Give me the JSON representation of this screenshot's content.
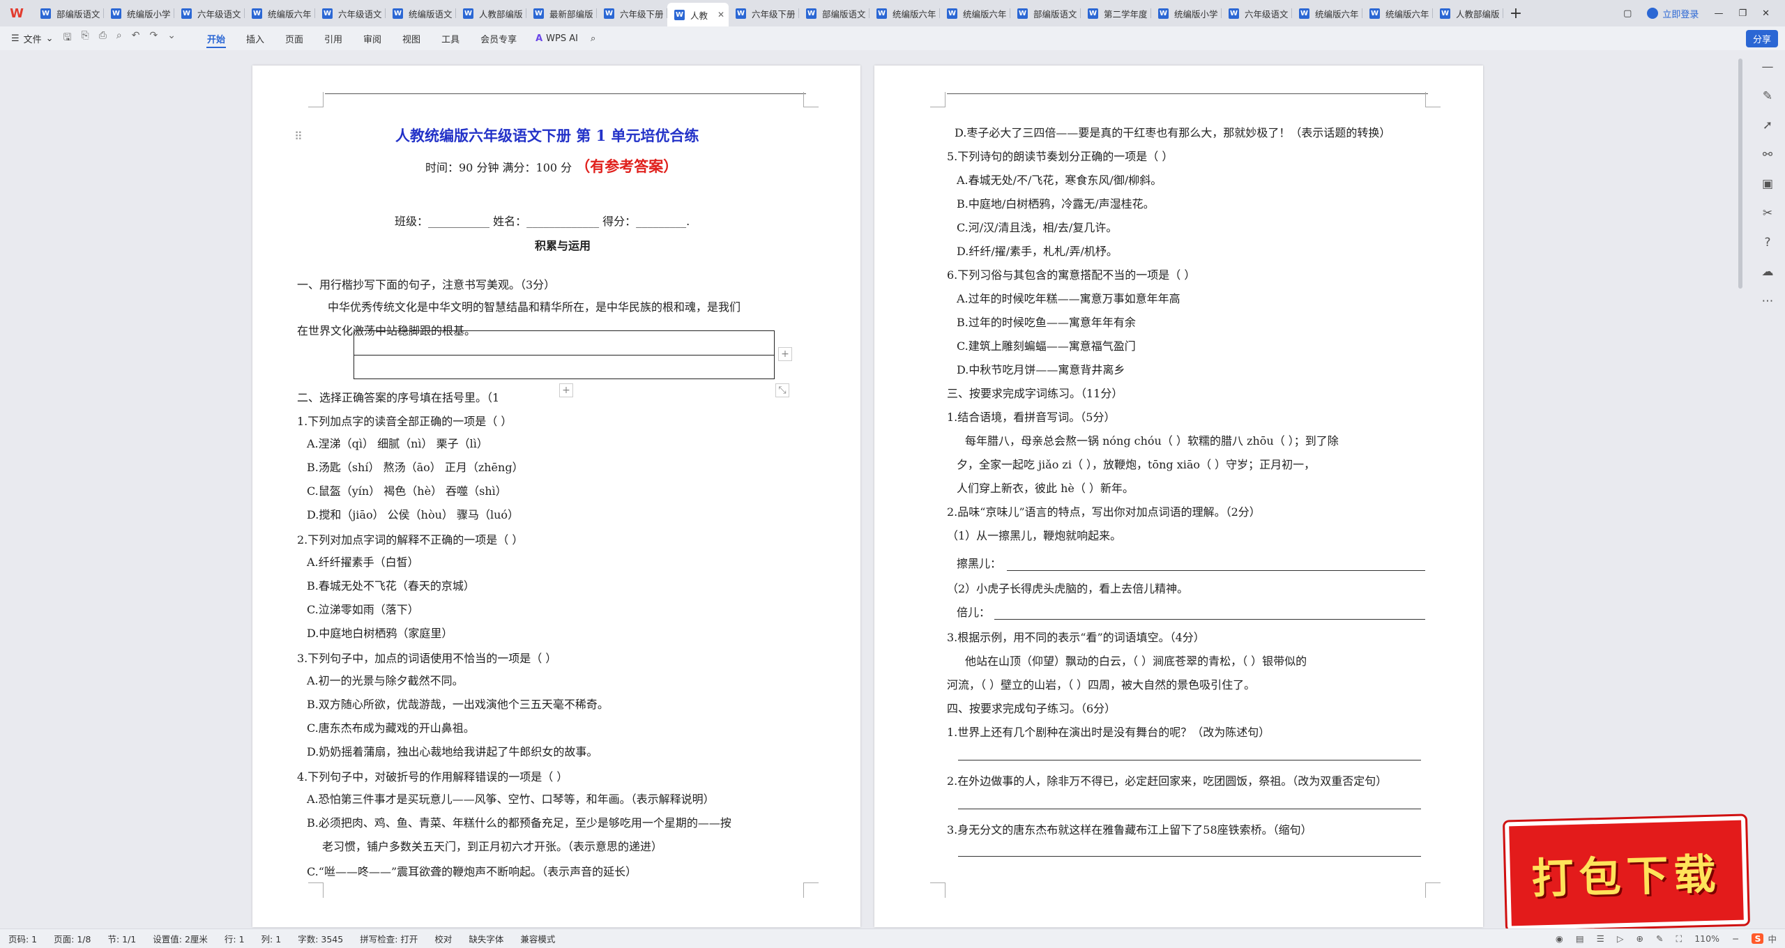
{
  "tabbar": {
    "logo": "W",
    "tabs": [
      {
        "label": "部编版语文"
      },
      {
        "label": "统编版小学"
      },
      {
        "label": "六年级语文"
      },
      {
        "label": "统编版六年"
      },
      {
        "label": "六年级语文"
      },
      {
        "label": "统编版语文"
      },
      {
        "label": "人教部编版"
      },
      {
        "label": "最新部编版"
      },
      {
        "label": "六年级下册"
      },
      {
        "label": "人教",
        "active": true
      },
      {
        "label": "六年级下册"
      },
      {
        "label": "部编版语文"
      },
      {
        "label": "统编版六年"
      },
      {
        "label": "统编版六年"
      },
      {
        "label": "部编版语文"
      },
      {
        "label": "第二学年度"
      },
      {
        "label": "统编版小学"
      },
      {
        "label": "六年级语文"
      },
      {
        "label": "统编版六年"
      },
      {
        "label": "统编版六年"
      },
      {
        "label": "人教部编版"
      }
    ],
    "add": "+",
    "login": "立即登录"
  },
  "toolbar": {
    "file": "文件",
    "menus": [
      "开始",
      "插入",
      "页面",
      "引用",
      "审阅",
      "视图",
      "工具",
      "会员专享"
    ],
    "active_menu": "开始",
    "wps_ai": "WPS AI",
    "share": "分享"
  },
  "page1": {
    "title": "人教统编版六年级语文下册 第 1 单元培优合练",
    "subtitle": "时间：90 分钟 满分：100 分",
    "answer_note": "（有参考答案）",
    "info": "班级：___________  姓名：_____________  得分：_________.",
    "section": "积累与运用",
    "lines": [
      "一、用行楷抄写下面的句子，注意书写美观。（3分）",
      "中华优秀传统文化是中华文明的智慧结晶和精华所在，是中华民族的根和魂，是我们",
      "在世界文化激荡中站稳脚跟的根基。",
      "二、选择正确答案的序号填在括号里。（1",
      "1.下列加点字的读音全部正确的一项是（     ）",
      "A.涅涕（qì）         细腻（nì）          栗子（lì）",
      "B.汤匙（shí）        熬汤（āo）          正月（zhēng）",
      "C.鼠盔（yín）        褐色（hè）          吞噬（shì）",
      "D.搅和（jiāo）       公侯（hòu）         骤马（luó）",
      "2.下列对加点字词的解释不正确的一项是（     ）",
      "A.纤纤擢素手（白皙）",
      "B.春城无处不飞花（春天的京城）",
      "C.泣涕零如雨（落下）",
      "D.中庭地白树栖鸦（家庭里）",
      "3.下列句子中，加点的词语使用不恰当的一项是（     ）",
      "A.初一的光景与除夕截然不同。",
      "B.双方随心所欲，优哉游哉，一出戏演他个三五天毫不稀奇。",
      "C.唐东杰布成为藏戏的开山鼻祖。",
      "D.奶奶摇着蒲扇，独出心裁地给我讲起了牛郎织女的故事。",
      "4.下列句子中，对破折号的作用解释错误的一项是（     ）",
      "A.恐怕第三件事才是买玩意儿——风筝、空竹、口琴等，和年画。（表示解释说明）",
      "B.必须把肉、鸡、鱼、青菜、年糕什么的都预备充足，至少是够吃用一个星期的——按",
      "老习惯，铺户多数关五天门，到正月初六才开张。（表示意思的递进）",
      "C.“咝——咚——”震耳欲聋的鞭炮声不断响起。（表示声音的延长）"
    ]
  },
  "page2": {
    "lines": [
      "D.枣子必大了三四倍——要是真的干红枣也有那么大，那就妙极了！（表示话题的转换）",
      "5.下列诗句的朗读节奏划分正确的一项是（     ）",
      "A.春城无处/不/飞花，寒食东风/御/柳斜。",
      "B.中庭地/白树栖鸦，冷露无/声湿桂花。",
      "C.河/汉/清且浅，相/去/复几许。",
      "D.纤纤/擢/素手，札札/弄/机杼。",
      "6.下列习俗与其包含的寓意搭配不当的一项是（     ）",
      "A.过年的时候吃年糕——寓意万事如意年年高",
      "B.过年的时候吃鱼——寓意年年有余",
      "C.建筑上雕刻蝙蝠——寓意福气盈门",
      "D.中秋节吃月饼——寓意背井离乡",
      "三、按要求完成字词练习。（11分）",
      "1.结合语境，看拼音写词。（5分）",
      "每年腊八，母亲总会熬一锅 nóng chóu（        ）软糯的腊八 zhōu（     ）；到了除",
      "夕，全家一起吃 jiǎo zi（        ），放鞭炮，tōng xiāo（        ）守岁；正月初一，",
      "人们穿上新衣，彼此 hè（     ）新年。",
      "2.品味“京味儿”语言的特点，写出你对加点词语的理解。（2分）",
      "（1）从一擦黑儿，鞭炮就响起来。",
      "擦黑儿：",
      "（2）小虎子长得虎头虎脑的，看上去倍儿精神。",
      "倍儿：",
      "3.根据示例，用不同的表示“看”的词语填空。（4分）",
      "他站在山顶（仰望）飘动的白云，（        ）涧底苍翠的青松，（        ）银带似的",
      "河流，（        ）壁立的山岩，（        ）四周，被大自然的景色吸引住了。",
      "四、按要求完成句子练习。（6分）",
      "1.世界上还有几个剧种在演出时是没有舞台的呢？（改为陈述句）",
      "2.在外边做事的人，除非万不得已，必定赶回家来，吃团圆饭，祭祖。（改为双重否定句）",
      "3.身无分文的唐东杰布就这样在雅鲁藏布江上留下了58座铁索桥。（缩句）"
    ]
  },
  "promo": {
    "text": "打包下载"
  },
  "statusbar": {
    "items": [
      "页码: 1",
      "页面: 1/8",
      "节: 1/1",
      "设置值: 2厘米",
      "行: 1",
      "列: 1",
      "字数: 3545",
      "拼写检查: 打开",
      "校对",
      "缺失字体",
      "兼容模式"
    ],
    "zoom": "110%",
    "ime": "中"
  }
}
